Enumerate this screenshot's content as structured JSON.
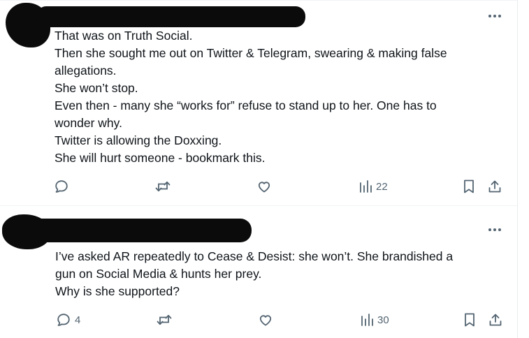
{
  "tweets": [
    {
      "lines": [
        "That was on Truth Social.",
        "Then she sought me out on Twitter & Telegram, swearing & making false",
        "allegations.",
        "She won’t stop.",
        "Even then - many she “works for” refuse to stand up to her. One has to",
        "wonder why.",
        "Twitter is allowing the Doxxing.",
        "She will hurt someone - bookmark this."
      ],
      "stats": {
        "replies": "",
        "retweets": "",
        "likes": "",
        "views": "22"
      }
    },
    {
      "lines": [
        "I’ve asked AR repeatedly to Cease & Desist: she won’t. She brandished a",
        "gun on Social Media & hunts her prey.",
        "Why is she supported?"
      ],
      "stats": {
        "replies": "4",
        "retweets": "",
        "likes": "",
        "views": "30"
      }
    }
  ],
  "icons": {
    "more": "more-horizontal-icon",
    "reply": "reply-bubble-icon",
    "retweet": "retweet-arrows-icon",
    "like": "heart-icon",
    "views": "views-bar-chart-icon",
    "bookmark": "bookmark-icon",
    "share": "share-upload-icon"
  },
  "colors": {
    "text": "#0f1419",
    "secondary": "#536471",
    "divider": "#eff3f4",
    "redaction": "#0b0b0b"
  }
}
